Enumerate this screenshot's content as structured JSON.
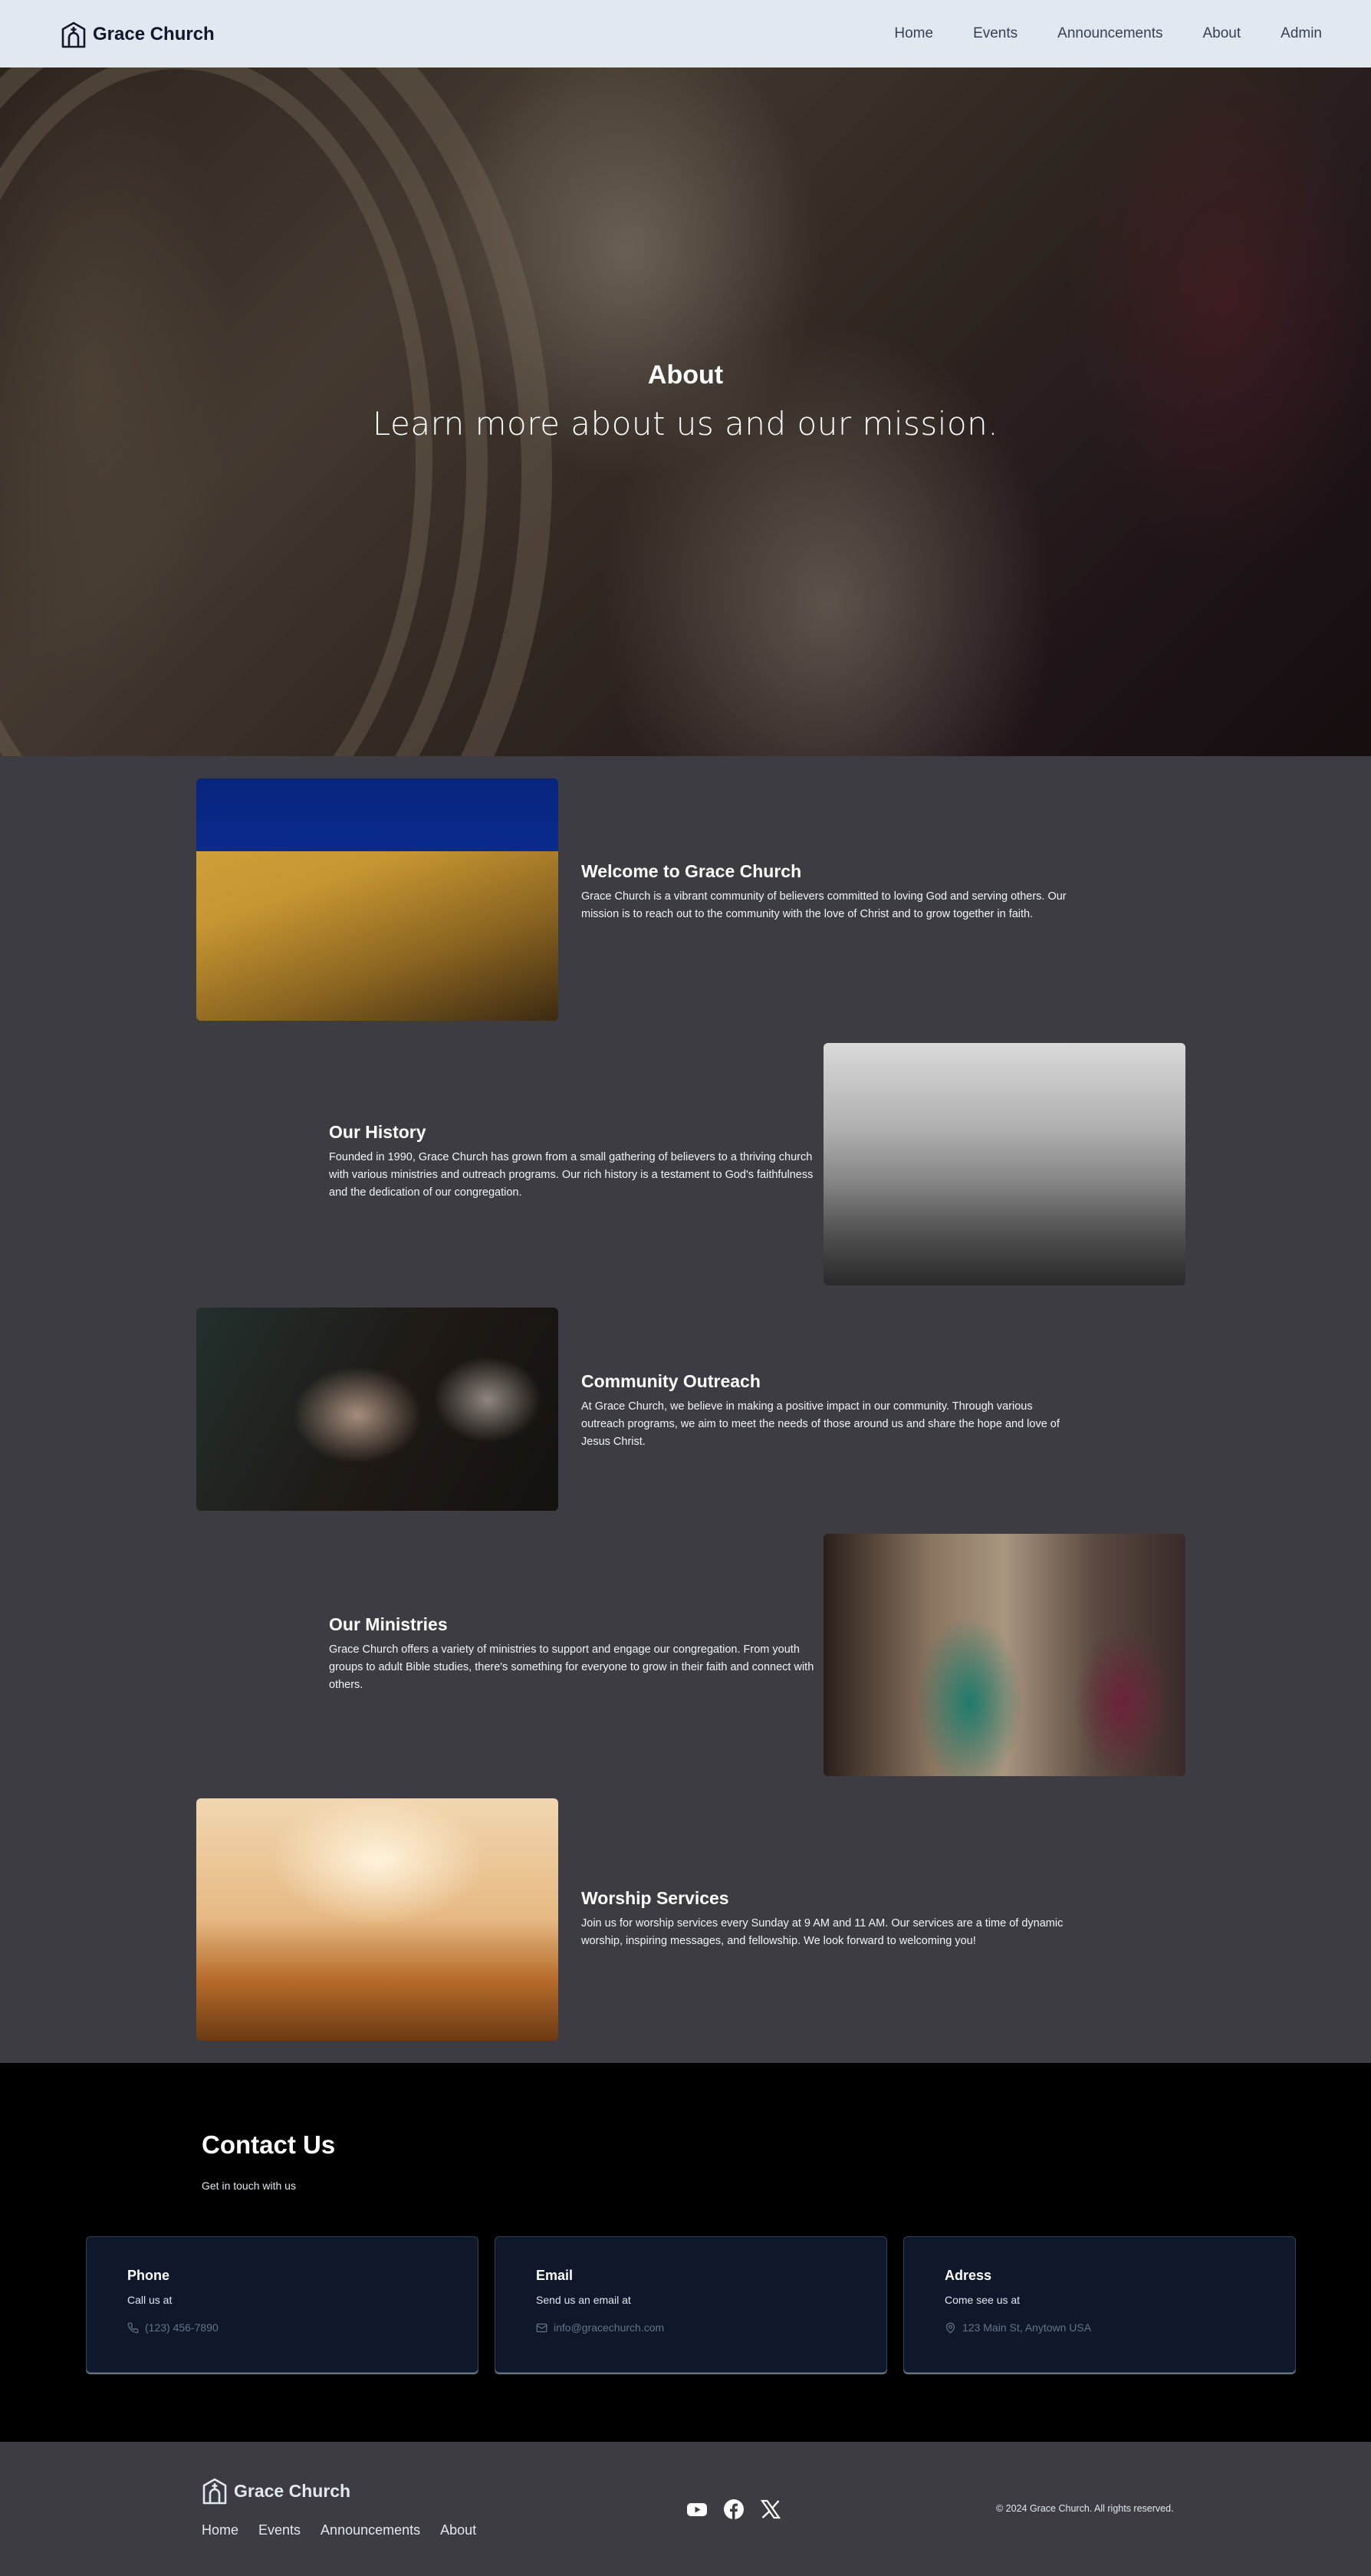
{
  "header": {
    "brand": "Grace Church",
    "nav": [
      "Home",
      "Events",
      "Announcements",
      "About",
      "Admin"
    ]
  },
  "hero": {
    "title": "About",
    "subtitle": "Learn more about us and our mission."
  },
  "sections": [
    {
      "title": "Welcome to Grace Church",
      "body": "Grace Church is a vibrant community of believers committed to loving God and serving others. Our mission is to reach out to the community with the love of Christ and to grow together in faith."
    },
    {
      "title": "Our History",
      "body": "Founded in 1990, Grace Church has grown from a small gathering of believers to a thriving church with various ministries and outreach programs. Our rich history is a testament to God's faithfulness and the dedication of our congregation."
    },
    {
      "title": "Community Outreach",
      "body": "At Grace Church, we believe in making a positive impact in our community. Through various outreach programs, we aim to meet the needs of those around us and share the hope and love of Jesus Christ."
    },
    {
      "title": "Our Ministries",
      "body": "Grace Church offers a variety of ministries to support and engage our congregation. From youth groups to adult Bible studies, there's something for everyone to grow in their faith and connect with others."
    },
    {
      "title": "Worship Services",
      "body": "Join us for worship services every Sunday at 9 AM and 11 AM. Our services are a time of dynamic worship, inspiring messages, and fellowship. We look forward to welcoming you!"
    }
  ],
  "contact": {
    "title": "Contact Us",
    "subtitle": "Get in touch with us",
    "cards": [
      {
        "title": "Phone",
        "desc": "Call us at",
        "value": "(123) 456-7890",
        "icon": "phone-icon"
      },
      {
        "title": "Email",
        "desc": "Send us an email at",
        "value": "info@gracechurch.com",
        "icon": "mail-icon"
      },
      {
        "title": "Adress",
        "desc": "Come see us at",
        "value": "123 Main St, Anytown USA",
        "icon": "map-pin-icon"
      }
    ]
  },
  "footer": {
    "brand": "Grace Church",
    "nav": [
      "Home",
      "Events",
      "Announcements",
      "About"
    ],
    "socials": [
      "youtube-icon",
      "facebook-icon",
      "x-icon"
    ],
    "copyright": "© 2024 Grace Church. All rights reserved."
  },
  "colors": {
    "navbar_bg": "#e2e8f0",
    "page_bg": "#3d3c43",
    "contact_bg": "#000000",
    "card_bg": "#0f172a"
  }
}
